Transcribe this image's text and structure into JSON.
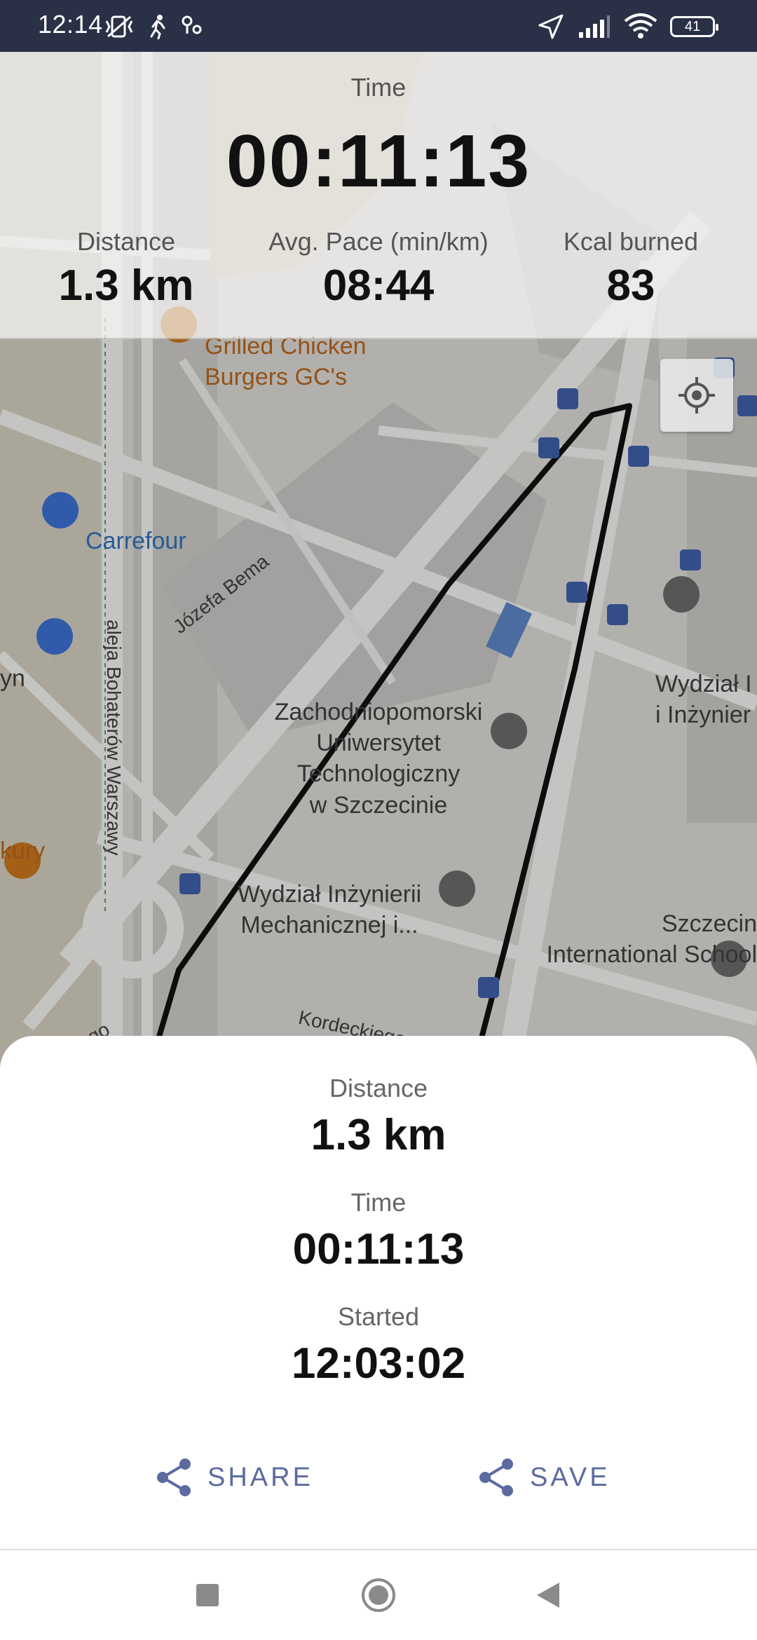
{
  "status_bar": {
    "time": "12:14",
    "battery": "41"
  },
  "top_panel": {
    "time_label": "Time",
    "time_value": "00:11:13",
    "stats": [
      {
        "label": "Distance",
        "value": "1.3 km"
      },
      {
        "label": "Avg. Pace (min/km)",
        "value": "08:44"
      },
      {
        "label": "Kcal burned",
        "value": "83"
      }
    ]
  },
  "map": {
    "labels": {
      "grilled": "Grilled Chicken\nBurgers GC's",
      "carrefour": "Carrefour",
      "jozefa": "Józefa Bema",
      "aleja": "aleja Bohaterów Warszawy",
      "zut": "Zachodniopomorski\nUniwersytet\nTechnologiczny\nw Szczecinie",
      "wydzial": "Wydział Inżynierii\nMechanicznej i...",
      "wydzial_right": "Wydział I\ni Inżynier",
      "szczecin": "Szczecin\nInternational School",
      "kordeckiego": "Kordeckiego",
      "sikorskiego": "ikorskiego",
      "yn": "yn",
      "kury": "kury"
    }
  },
  "summary": {
    "distance_label": "Distance",
    "distance_value": "1.3 km",
    "time_label": "Time",
    "time_value": "00:11:13",
    "started_label": "Started",
    "started_value": "12:03:02",
    "share_label": "SHARE",
    "save_label": "SAVE"
  }
}
